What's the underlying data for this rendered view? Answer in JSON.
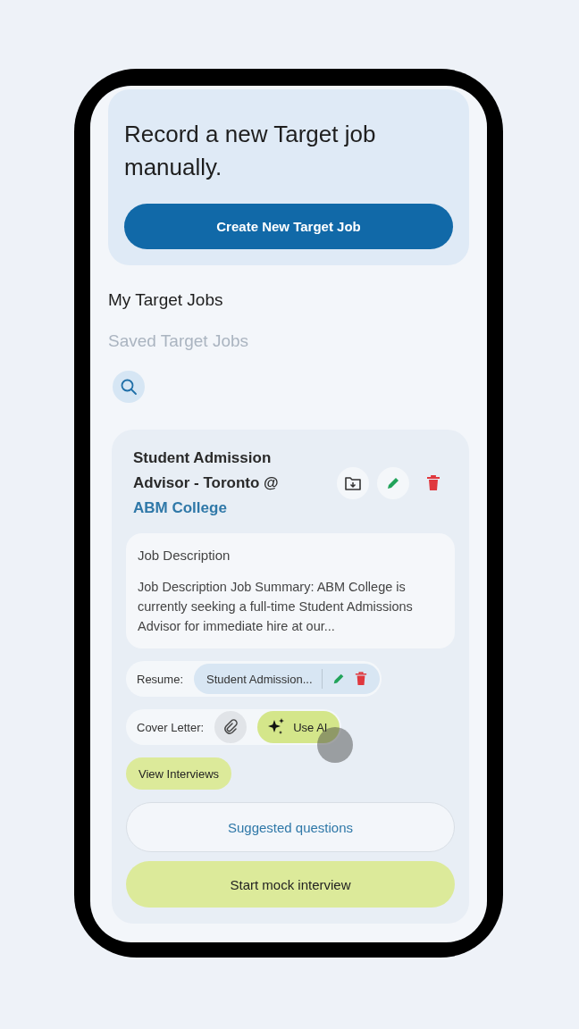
{
  "intro_card": {
    "heading": "Record a new Target job manually.",
    "button": "Create New Target Job"
  },
  "section_title": "My Target Jobs",
  "subtitle": "Saved Target Jobs",
  "job": {
    "title": "Student Admission Advisor - Toronto @",
    "company": "ABM College",
    "description": {
      "label": "Job Description",
      "text": "Job Description Job Summary: ABM College is currently seeking a full-time Student Admissions Advisor for immediate hire at our..."
    },
    "resume": {
      "label": "Resume:",
      "file": "Student Admission..."
    },
    "cover_letter": {
      "label": "Cover Letter:",
      "ai_button": "Use AI",
      "pressed": true
    },
    "view_interviews": "View Interviews",
    "suggested_questions": "Suggested questions",
    "start_button": "Start mock interview"
  }
}
